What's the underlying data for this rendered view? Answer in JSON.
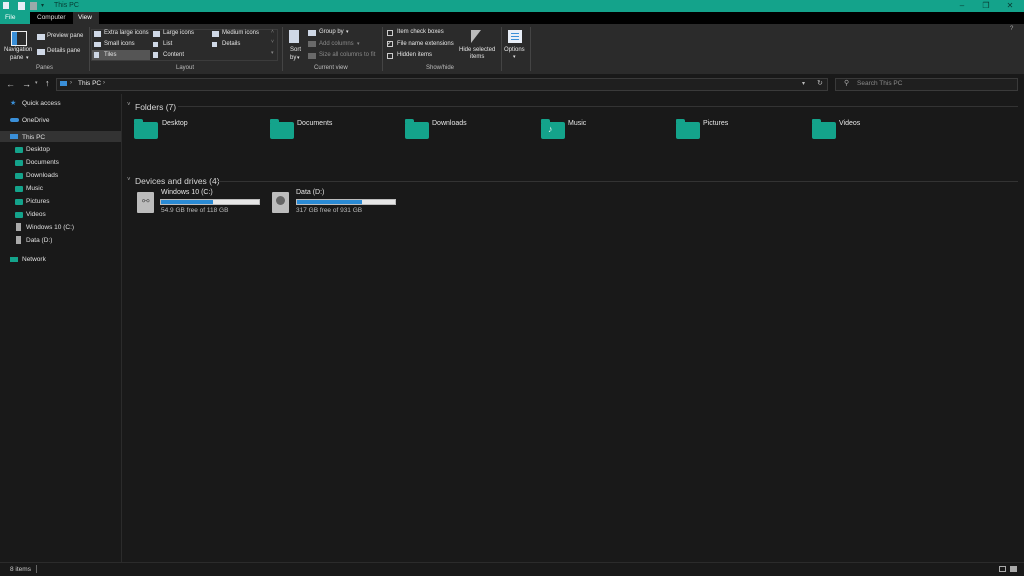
{
  "window": {
    "title": "This PC",
    "controls": [
      "–",
      "❐",
      "✕"
    ]
  },
  "tabs": [
    "File",
    "Computer",
    "View"
  ],
  "ribbon": {
    "panes": {
      "navigation_pane_l1": "Navigation",
      "navigation_pane_l2": "pane",
      "preview_pane": "Preview pane",
      "details_pane": "Details pane",
      "group_label": "Panes"
    },
    "layout": {
      "extra_large_icons": "Extra large icons",
      "large_icons": "Large icons",
      "medium_icons": "Medium icons",
      "small_icons": "Small icons",
      "list": "List",
      "details": "Details",
      "tiles": "Tiles",
      "content": "Content",
      "group_label": "Layout"
    },
    "current_view": {
      "sort_l1": "Sort",
      "sort_l2": "by",
      "group_by": "Group by",
      "add_columns": "Add columns",
      "size_all_columns": "Size all columns to fit",
      "group_label": "Current view"
    },
    "show_hide": {
      "item_check_boxes": "Item check boxes",
      "file_name_extensions": "File name extensions",
      "hidden_items": "Hidden items",
      "hide_selected_l1": "Hide selected",
      "hide_selected_l2": "items",
      "group_label": "Show/hide"
    },
    "options": "Options"
  },
  "address": {
    "path": "This PC",
    "search_placeholder": "Search This PC"
  },
  "sidebar": {
    "quick_access": "Quick access",
    "onedrive": "OneDrive",
    "this_pc": "This PC",
    "children": [
      "Desktop",
      "Documents",
      "Downloads",
      "Music",
      "Pictures",
      "Videos",
      "Windows 10 (C:)",
      "Data (D:)"
    ],
    "network": "Network"
  },
  "folders": {
    "heading": "Folders (7)",
    "items": [
      "Desktop",
      "Documents",
      "Downloads",
      "Music",
      "Pictures",
      "Videos"
    ]
  },
  "drives": {
    "heading": "Devices and drives (4)",
    "items": [
      {
        "name": "Windows 10 (C:)",
        "free": "54.9 GB free of 118 GB",
        "used_fraction": 0.535
      },
      {
        "name": "Data (D:)",
        "free": "317 GB free of 931 GB",
        "used_fraction": 0.66
      }
    ]
  },
  "status": {
    "item_count": "8 items"
  },
  "colors": {
    "accent": "#14a38b",
    "drive_bar": "#2a8ad4",
    "background": "#191919"
  }
}
